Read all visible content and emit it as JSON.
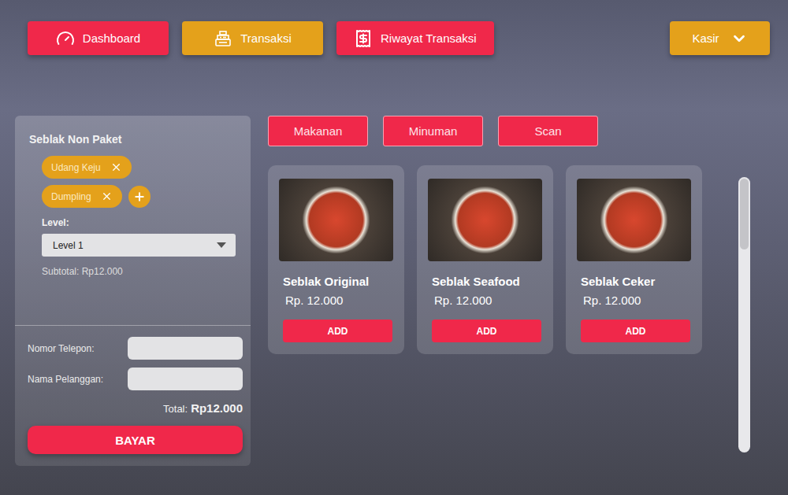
{
  "nav": [
    {
      "label": "Dashboard",
      "selected": false,
      "kind": "gauge"
    },
    {
      "label": "Transaksi",
      "selected": true,
      "kind": "register"
    },
    {
      "label": "Riwayat Transaksi",
      "selected": false,
      "kind": "receipt"
    }
  ],
  "user_menu": {
    "label": "Kasir"
  },
  "order": {
    "title": "Seblak Non Paket",
    "toppings": [
      {
        "label": "Udang Keju"
      },
      {
        "label": "Dumpling"
      }
    ],
    "level_label": "Level:",
    "level_value": "Level 1",
    "subtotal": "Subtotal: Rp12.000"
  },
  "customer": {
    "fields": [
      {
        "label": "Nomor Telepon:",
        "value": ""
      },
      {
        "label": "Nama Pelanggan:",
        "value": ""
      }
    ],
    "total_label": "Total:",
    "total": "Rp12.000",
    "pay_button": "BAYAR"
  },
  "categories": [
    {
      "label": "Makanan",
      "selected": false
    },
    {
      "label": "Minuman",
      "selected": false
    },
    {
      "label": "Scan",
      "selected": false
    }
  ],
  "products": [
    {
      "name": "Seblak Original",
      "price": "Rp. 12.000",
      "button": "ADD"
    },
    {
      "name": "Seblak Seafood",
      "price": "Rp. 12.000",
      "button": "ADD"
    },
    {
      "name": "Seblak Ceker",
      "price": "Rp. 12.000",
      "button": "ADD"
    }
  ],
  "scrollbar": {
    "level": 0.26
  }
}
